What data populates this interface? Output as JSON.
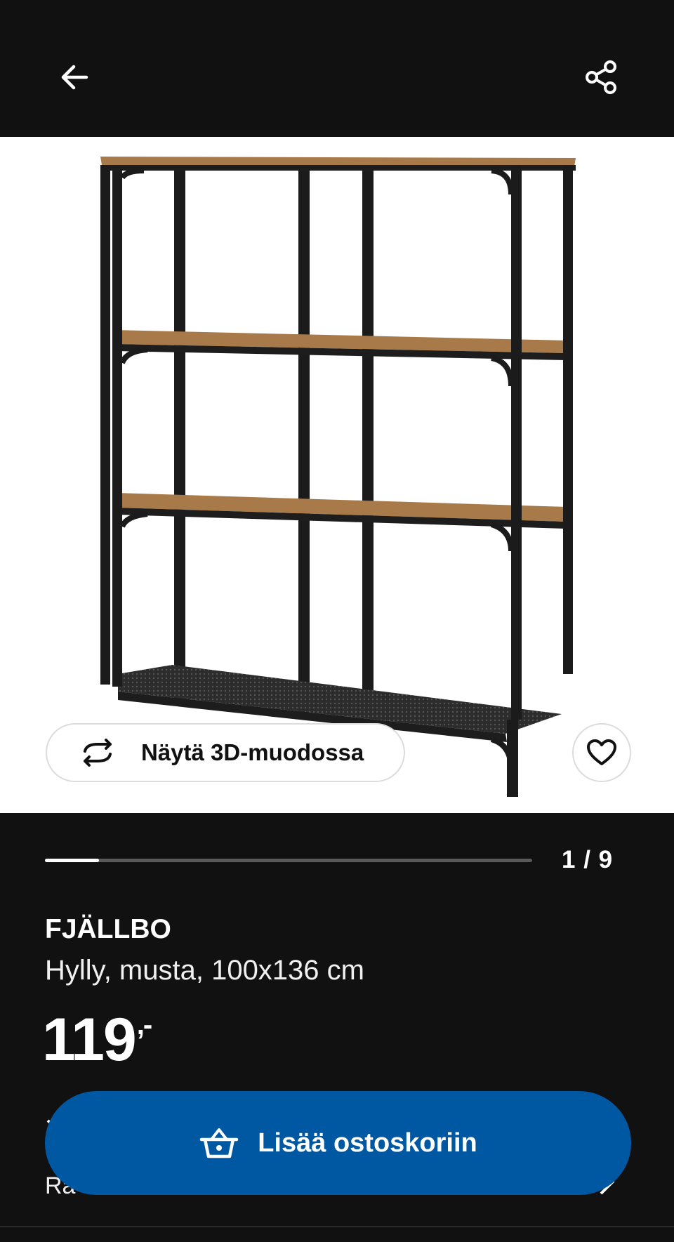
{
  "topbar": {
    "back_icon": "arrow-left-icon",
    "share_icon": "share-icon"
  },
  "product_image": {
    "alt": "FJÄLLBO shelving unit"
  },
  "view_3d": {
    "label": "Näytä 3D-muodossa",
    "icon": "rotate-3d-icon"
  },
  "favorite": {
    "icon": "heart-icon"
  },
  "gallery": {
    "progress": 0.111,
    "counter": "1 / 9"
  },
  "product": {
    "brand": "FJÄLLBO",
    "description": "Hylly, musta, 100x136 cm",
    "price": "119",
    "price_suffix": ",-"
  },
  "partially_hidden": {
    "text": "Ra"
  },
  "cart_button": {
    "label": "Lisää ostoskoriin",
    "icon": "basket-icon"
  },
  "colors": {
    "background": "#111111",
    "accent": "#0058a3",
    "wood": "#a87a49"
  }
}
